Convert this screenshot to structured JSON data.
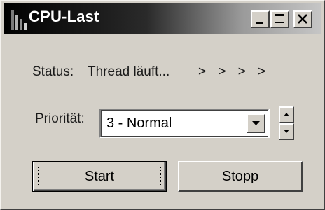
{
  "window": {
    "title": "CPU-Last",
    "minimize_icon": "minimize-icon",
    "maximize_icon": "maximize-icon",
    "close_icon": "close-icon",
    "app_icon": "cpu-meter-icon"
  },
  "status": {
    "label": "Status:",
    "value": "Thread läuft...",
    "indicator": ">  >  >  >"
  },
  "priority": {
    "label": "Priorität:",
    "selected": "3 - Normal",
    "dropdown_icon": "chevron-down-icon",
    "spin_up_icon": "arrow-up-icon",
    "spin_down_icon": "arrow-down-icon"
  },
  "buttons": {
    "start": "Start",
    "stop": "Stopp"
  },
  "colors": {
    "face": "#d4d0c8",
    "titlebar_start": "#000000",
    "titlebar_end": "#c6c6c6",
    "title_text": "#ffffff"
  }
}
